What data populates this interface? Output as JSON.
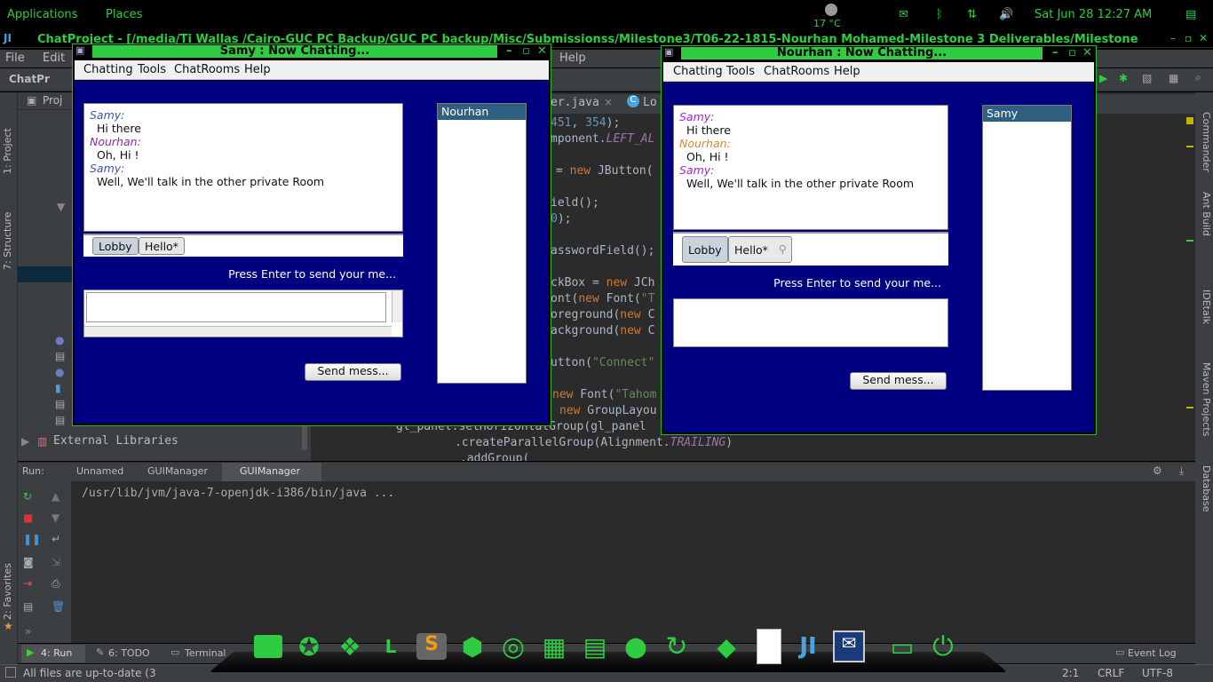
{
  "top_panel": {
    "applications": "Applications",
    "places": "Places",
    "weather": "17 °C",
    "datetime": "Sat Jun 28 12:27 AM"
  },
  "ide": {
    "title": "ChatProject - [/media/Ti Wallas /Cairo-GUC PC Backup/GUC PC backup/Misc/Submissionss/Milestone3/T06-22-1815-Nourhan Mohamed-Milestone 3 Deliverables/Milestone",
    "menu": [
      "File",
      "Edit",
      "Help"
    ],
    "project_crumb": "ChatPr",
    "project_tab": "Proj",
    "editor_tabs": [
      "er.java",
      "Lo"
    ],
    "external_libraries": "External Libraries",
    "side_left": [
      "1: Project",
      "7: Structure",
      "2: Favorites"
    ],
    "side_right": [
      "Commander",
      "Ant Build",
      "IDEtalk",
      "Maven Projects",
      "Database"
    ],
    "code_lines": [
      "451, 354);",
      "mponent.LEFT_AL",
      "= new JButton(",
      "ield();",
      "0);",
      "asswordField();",
      "ckBox = new JCh",
      "ont(new Font(\"T",
      "oreground(new C",
      "ackground(new C",
      "utton(\"Connect\"",
      "new Font(\"Tahom",
      "new GroupLayou",
      "gl_panel.setHorizontalGroup(gl_panel",
      ".createParallelGroup(Alignment.TRAILING)",
      ".addGroup("
    ],
    "run": {
      "label": "Run:",
      "tabs": [
        "Unnamed",
        "GUIManager",
        "GUIManager"
      ],
      "command": "/usr/lib/jvm/java-7-openjdk-i386/bin/java ..."
    },
    "bottom_tabs": [
      "4: Run",
      "6: TODO",
      "Terminal"
    ],
    "event_log": "Event Log",
    "status_text": "All files are up-to-date (3",
    "status_pos": "2:1",
    "status_crlf": "CRLF",
    "status_enc": "UTF-8"
  },
  "chat_left": {
    "title": "Samy : Now Chatting...",
    "menu": [
      "Chatting",
      "Tools",
      "ChatRooms",
      "Help"
    ],
    "messages": [
      {
        "sender": "Samy:",
        "text": "Hi there"
      },
      {
        "sender": "Nourhan:",
        "text": "Oh, Hi !"
      },
      {
        "sender": "Samy:",
        "text": "Well, We'll talk in the other private Room"
      }
    ],
    "tabs": [
      "Lobby",
      "Hello*"
    ],
    "hint": "Press Enter to send your me...",
    "send_button": "Send mess...",
    "users_header": "Nourhan",
    "colors": {
      "samy": "#3b5a9a",
      "nourhan": "#8a2aa8"
    }
  },
  "chat_right": {
    "title": "Nourhan : Now Chatting...",
    "menu": [
      "Chatting",
      "Tools",
      "ChatRooms",
      "Help"
    ],
    "messages": [
      {
        "sender": "Samy:",
        "text": "Hi there"
      },
      {
        "sender": "Nourhan:",
        "text": "Oh, Hi !"
      },
      {
        "sender": "Samy:",
        "text": "Well, We'll talk in the other private Room"
      }
    ],
    "tabs": [
      "Lobby",
      "Hello*"
    ],
    "hint": "Press Enter to send your me...",
    "send_button": "Send mess...",
    "users_header": "Samy",
    "colors": {
      "samy": "#9a2ac8",
      "nourhan": "#d08a3a"
    }
  },
  "dock": {
    "icons": [
      "terminal-icon",
      "gimp-icon",
      "dropbox-icon",
      "lyx-icon",
      "sublime-icon",
      "virtualbox-icon",
      "chrome-icon",
      "calculator-icon",
      "document-icon",
      "globe-icon",
      "refresh-icon",
      "tag-icon",
      "text-file-icon",
      "intellij-icon",
      "chat-icon",
      "screen-icon",
      "power-icon"
    ]
  },
  "theme": {
    "green": "#2ecc40",
    "chat_bg": "#000080",
    "list_header": "#2f6082"
  }
}
